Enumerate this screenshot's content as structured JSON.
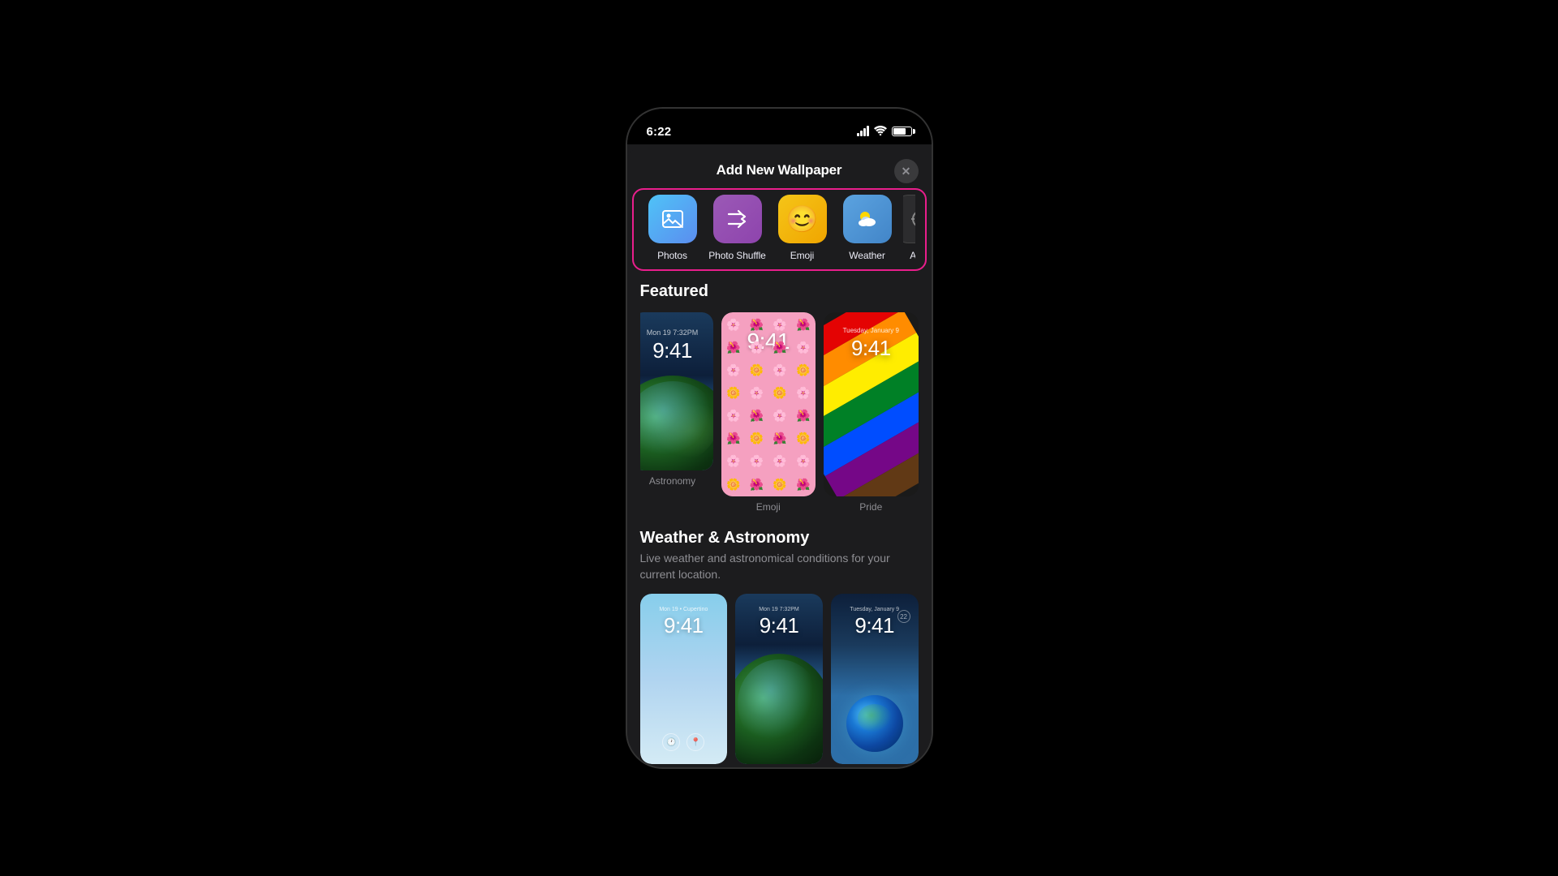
{
  "statusBar": {
    "time": "6:22",
    "signal": "●●●●",
    "wifi": "wifi",
    "battery": "battery"
  },
  "modal": {
    "title": "Add New Wallpaper",
    "closeLabel": "✕"
  },
  "categories": [
    {
      "id": "photos",
      "label": "Photos",
      "iconClass": "photos",
      "emoji": "🖼"
    },
    {
      "id": "shuffle",
      "label": "Photo Shuffle",
      "iconClass": "shuffle",
      "emoji": "⇄"
    },
    {
      "id": "emoji",
      "label": "Emoji",
      "iconClass": "emoji",
      "emoji": "😊"
    },
    {
      "id": "weather",
      "label": "Weather",
      "iconClass": "weather",
      "emoji": "⛅"
    },
    {
      "id": "astro",
      "label": "Astro",
      "iconClass": "astro",
      "emoji": "◎"
    }
  ],
  "featured": {
    "sectionTitle": "Featured",
    "items": [
      {
        "id": "astronomy",
        "label": "Astronomy",
        "time": "9:41",
        "timeSmall": "Mon 19  7:32PM"
      },
      {
        "id": "emoji",
        "label": "Emoji",
        "time": "9:41",
        "timeSmall": ""
      },
      {
        "id": "pride",
        "label": "Pride",
        "time": "9:41",
        "timeSmall": "Tuesday, January 9"
      }
    ]
  },
  "weatherSection": {
    "sectionTitle": "Weather & Astronomy",
    "subtitle": "Live weather and astronomical conditions for your current location.",
    "items": [
      {
        "id": "weather1",
        "label": "",
        "time": "9:41",
        "timeSmall": "Mon 19 • Cupertino"
      },
      {
        "id": "weather2",
        "label": "",
        "time": "9:41",
        "timeSmall": "Mon 19  7:32PM"
      },
      {
        "id": "weather3",
        "label": "",
        "time": "9:41",
        "timeSmall": "Tuesday, January 9"
      }
    ],
    "scrollIndicator": [
      "active",
      "inactive"
    ]
  }
}
